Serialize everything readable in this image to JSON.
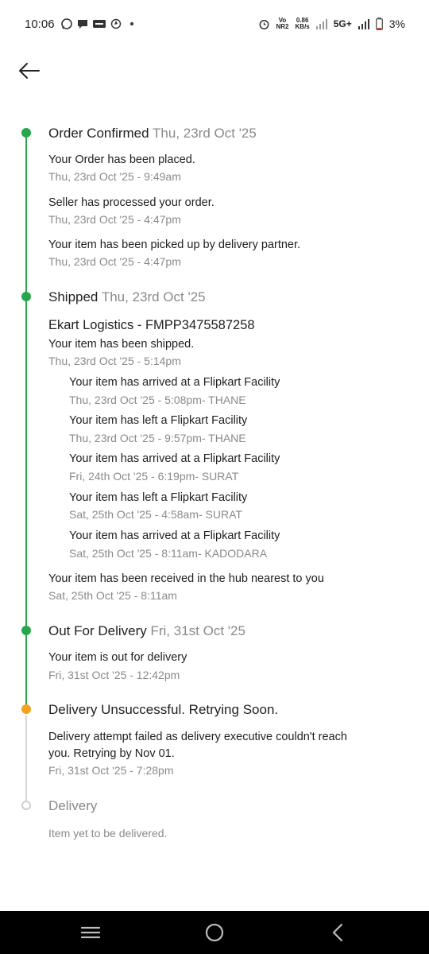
{
  "status_bar": {
    "time": "10:06",
    "network_speed_value": "0.86",
    "network_speed_unit": "KB/s",
    "volte": "Vo",
    "nr": "NR2",
    "network_type": "5G+",
    "battery": "3%"
  },
  "stages": [
    {
      "title": "Order Confirmed",
      "date": "Thu, 23rd Oct '25",
      "status": "done",
      "events": [
        {
          "text": "Your Order has been placed.",
          "time": "Thu, 23rd Oct '25 - 9:49am"
        },
        {
          "text": "Seller has processed your order.",
          "time": "Thu, 23rd Oct '25 - 4:47pm"
        },
        {
          "text": "Your item has been picked up by delivery partner.",
          "time": "Thu, 23rd Oct '25 - 4:47pm"
        }
      ]
    },
    {
      "title": "Shipped",
      "date": "Thu, 23rd Oct '25",
      "status": "done",
      "courier": "Ekart Logistics - FMPP3475587258",
      "events": [
        {
          "text": "Your item has been shipped.",
          "time": "Thu, 23rd Oct '25 - 5:14pm"
        }
      ],
      "sub_events": [
        {
          "text": "Your item has arrived at a Flipkart Facility",
          "time": "Thu, 23rd Oct '25 - 5:08pm- THANE"
        },
        {
          "text": "Your item has left a Flipkart Facility",
          "time": "Thu, 23rd Oct '25 - 9:57pm- THANE"
        },
        {
          "text": "Your item has arrived at a Flipkart Facility",
          "time": "Fri, 24th Oct '25 - 6:19pm- SURAT"
        },
        {
          "text": "Your item has left a Flipkart Facility",
          "time": "Sat, 25th Oct '25 - 4:58am- SURAT"
        },
        {
          "text": "Your item has arrived at a Flipkart Facility",
          "time": "Sat, 25th Oct '25 - 8:11am- KADODARA"
        }
      ],
      "final_event": {
        "text": "Your item has been received in the hub nearest to you",
        "time": "Sat, 25th Oct '25 - 8:11am"
      }
    },
    {
      "title": "Out For Delivery",
      "date": "Fri, 31st Oct '25",
      "status": "done",
      "events": [
        {
          "text": "Your item is out for delivery",
          "time": "Fri, 31st Oct '25 - 12:42pm"
        }
      ]
    },
    {
      "title": "Delivery Unsuccessful. Retrying Soon.",
      "status": "warning",
      "events": [
        {
          "text_line1": "Delivery attempt failed as delivery executive couldn't reach",
          "text_line2": "you. Retrying by Nov 01.",
          "time": "Fri, 31st Oct '25 - 7:28pm"
        }
      ]
    },
    {
      "title": "Delivery",
      "status": "pending",
      "note": "Item yet to be delivered."
    }
  ],
  "colors": {
    "done": "#27a74a",
    "warning": "#f6a21b",
    "pending": "#cfcfcf",
    "secondary_text": "#8a8a8a"
  },
  "icons": [
    "back-arrow-icon",
    "whatsapp-icon",
    "chat-icon",
    "paytm-icon",
    "steam-icon",
    "alarm-icon",
    "signal-icon",
    "battery-icon",
    "menu-icon",
    "home-icon",
    "back-nav-icon"
  ]
}
